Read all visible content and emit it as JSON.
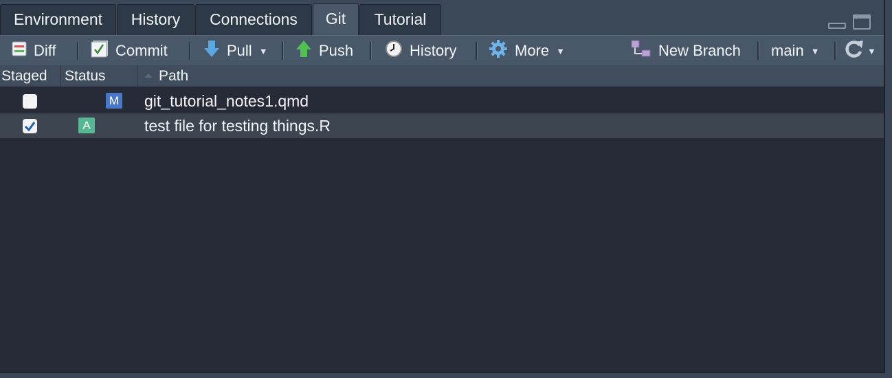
{
  "tabs": [
    {
      "label": "Environment",
      "active": false
    },
    {
      "label": "History",
      "active": false
    },
    {
      "label": "Connections",
      "active": false
    },
    {
      "label": "Git",
      "active": true
    },
    {
      "label": "Tutorial",
      "active": false
    }
  ],
  "toolbar": {
    "diff": "Diff",
    "commit": "Commit",
    "pull": "Pull",
    "push": "Push",
    "history": "History",
    "more": "More",
    "new_branch": "New Branch",
    "branch": "main"
  },
  "columns": {
    "staged": "Staged",
    "status": "Status",
    "path": "Path"
  },
  "files": [
    {
      "staged": false,
      "status": "M",
      "status_color": "#4a78c8",
      "path": "git_tutorial_notes1.qmd"
    },
    {
      "staged": true,
      "status": "A",
      "status_color": "#56b892",
      "path": "test file for testing things.R"
    }
  ],
  "colors": {
    "pane_bg": "#272b37",
    "toolbar_bg": "#495869",
    "selected_row": "#3d4551"
  }
}
